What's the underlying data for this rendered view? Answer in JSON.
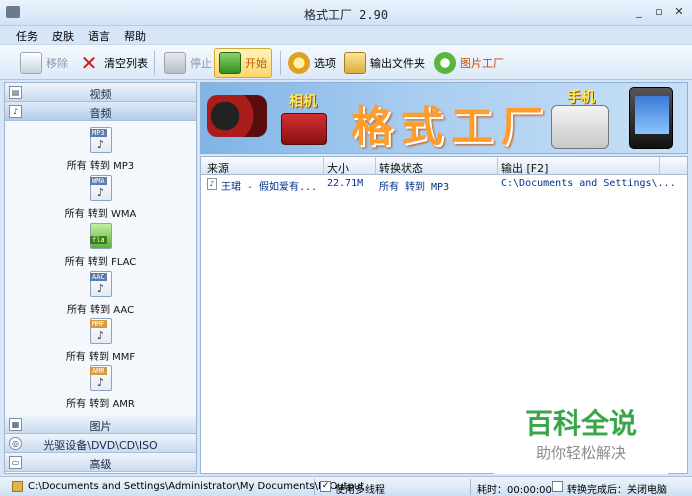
{
  "window": {
    "title": "格式工厂 2.90"
  },
  "menu": [
    "任务",
    "皮肤",
    "语言",
    "帮助"
  ],
  "toolbar": {
    "remove": "移除",
    "clear_list": "清空列表",
    "stop": "停止",
    "start": "开始",
    "options": "选项",
    "output_folder": "输出文件夹",
    "picture_factory": "图片工厂"
  },
  "sidebar": {
    "categories_top": [
      {
        "label": "视频",
        "icon": "video-icon"
      },
      {
        "label": "音频",
        "icon": "audio-icon"
      }
    ],
    "formats": [
      {
        "tag": "MP3",
        "label": "所有 转到 MP3"
      },
      {
        "tag": "WMA",
        "label": "所有 转到 WMA"
      },
      {
        "tag": "fla",
        "label": "所有 转到 FLAC"
      },
      {
        "tag": "AAC",
        "label": "所有 转到 AAC"
      },
      {
        "tag": "MMF",
        "label": "所有 转到 MMF"
      },
      {
        "tag": "AMR",
        "label": "所有 转到 AMR"
      }
    ],
    "categories_bottom": [
      {
        "label": "图片",
        "icon": "picture-icon"
      },
      {
        "label": "光驱设备\\DVD\\CD\\ISO",
        "icon": "disc-icon"
      },
      {
        "label": "高级",
        "icon": "advanced-icon"
      }
    ]
  },
  "banner": {
    "camera_label": "相机",
    "brand": "格式工厂",
    "phone_label": "手机"
  },
  "file_list": {
    "columns": [
      "来源",
      "大小",
      "转换状态",
      "输出 [F2]"
    ],
    "rows": [
      {
        "source": "王珺 - 假如爱有...",
        "size": "22.71M",
        "status": "所有 转到 MP3",
        "output": "C:\\Documents and Settings\\..."
      }
    ]
  },
  "watermark": {
    "line1": "百科全说",
    "line2": "助你轻松解决"
  },
  "statusbar": {
    "output_path": "C:\\Documents and Settings\\Administrator\\My Documents\\FFOutput",
    "multithread_label": "使用多线程",
    "multithread_checked": "✓",
    "elapsed": "耗时：00:00:00",
    "after_done": "转换完成后：关闭电脑"
  }
}
